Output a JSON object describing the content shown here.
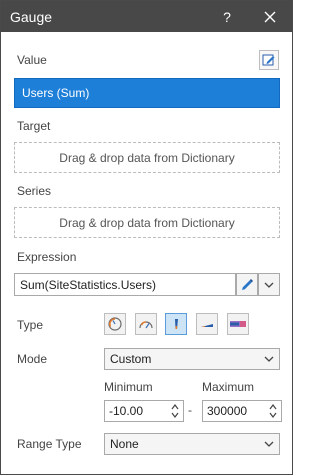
{
  "window": {
    "title": "Gauge",
    "help": "?"
  },
  "value": {
    "label": "Value",
    "field": "Users (Sum)"
  },
  "target": {
    "label": "Target",
    "placeholder": "Drag & drop data from Dictionary"
  },
  "series": {
    "label": "Series",
    "placeholder": "Drag & drop data from Dictionary"
  },
  "expression": {
    "label": "Expression",
    "value": "Sum(SiteStatistics.Users)"
  },
  "type": {
    "label": "Type",
    "selected_index": 2
  },
  "mode": {
    "label": "Mode",
    "value": "Custom"
  },
  "range": {
    "min_label": "Minimum",
    "min_value": "-10.00",
    "separator": "-",
    "max_label": "Maximum",
    "max_value": "300000"
  },
  "range_type": {
    "label": "Range Type",
    "value": "None"
  },
  "colors": {
    "accent": "#1e7fd8",
    "titlebar": "#484848"
  }
}
